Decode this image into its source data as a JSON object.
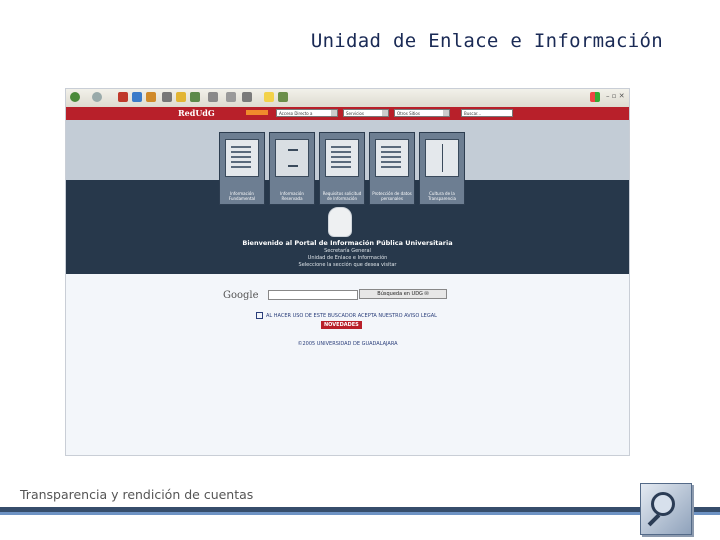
{
  "slide": {
    "title": "Unidad de Enlace e Información",
    "footer": "Transparencia y rendición de cuentas"
  },
  "browser": {
    "toolbar_icons": [
      "back-icon",
      "forward-icon",
      "stop-icon",
      "refresh-icon",
      "home-icon",
      "search-icon",
      "favorites-icon",
      "history-icon",
      "mail-icon",
      "print-icon",
      "edit-icon",
      "folder-icon",
      "messenger-icon",
      "windows-logo-icon"
    ]
  },
  "site": {
    "nav_logo": "RedUdG",
    "selects": [
      "Acceso Directo a",
      "Servicios",
      "Otros Sitios",
      "Buscar..."
    ],
    "cards": [
      {
        "label": "Información Fundamental"
      },
      {
        "label": "Información Reservada"
      },
      {
        "label": "Requisitos solicitud de Información"
      },
      {
        "label": "Protección de datos personales"
      },
      {
        "label": "Cultura de la Transparencia"
      }
    ],
    "welcome": "Bienvenido al Portal de Información Pública Universitaria",
    "sub1": "Secretaría General",
    "sub2": "Unidad de Enlace e Información",
    "sub3": "Seleccione la sección que desea visitar",
    "google_label": "Google",
    "google_button": "Búsqueda en UDG ✉",
    "legal": "AL HACER USO DE ESTE BUSCADOR ACEPTA NUESTRO AVISO LEGAL",
    "news_button": "NOVEDADES",
    "copyright": "©2005 UNIVERSIDAD DE GUADALAJARA"
  },
  "colors": {
    "navbar": "#b8202a",
    "dark_band": "#27384b",
    "footer_rule": "#364d6b"
  }
}
